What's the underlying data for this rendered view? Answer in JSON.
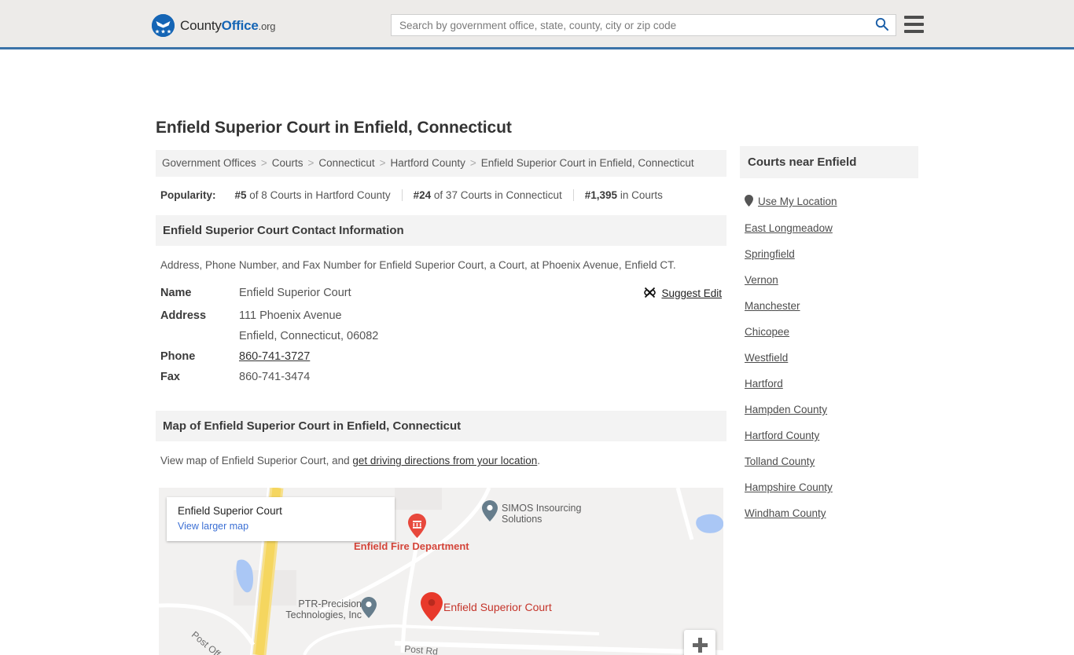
{
  "header": {
    "logo": {
      "part1": "County",
      "part2": "Office",
      "part3": ".org",
      "icon": "eagle-shield-logo"
    },
    "search": {
      "placeholder": "Search by government office, state, county, city or zip code",
      "value": "",
      "icon": "search-icon"
    },
    "menu_icon": "hamburger-menu-icon"
  },
  "page": {
    "title": "Enfield Superior Court in Enfield, Connecticut"
  },
  "breadcrumb": {
    "items": [
      "Government Offices",
      "Courts",
      "Connecticut",
      "Hartford County",
      "Enfield Superior Court in Enfield, Connecticut"
    ],
    "separator": ">"
  },
  "popularity": {
    "label": "Popularity:",
    "items": [
      {
        "rank": "#5",
        "rest": " of 8 Courts in Hartford County"
      },
      {
        "rank": "#24",
        "rest": " of 37 Courts in Connecticut"
      },
      {
        "rank": "#1,395",
        "rest": " in Courts"
      }
    ]
  },
  "contact": {
    "heading": "Enfield Superior Court Contact Information",
    "description": "Address, Phone Number, and Fax Number for Enfield Superior Court, a Court, at Phoenix Avenue, Enfield CT.",
    "rows": [
      {
        "key": "Name",
        "value": "Enfield Superior Court",
        "link": false
      },
      {
        "key": "Address",
        "value": "111 Phoenix Avenue",
        "link": false
      },
      {
        "key": "",
        "value": "Enfield, Connecticut, 06082",
        "link": false
      },
      {
        "key": "Phone",
        "value": "860-741-3727",
        "link": true
      },
      {
        "key": "Fax",
        "value": "860-741-3474",
        "link": false
      }
    ],
    "suggest_edit": {
      "label": "Suggest Edit",
      "icon": "edit-pencil-icon"
    }
  },
  "map_section": {
    "heading": "Map of Enfield Superior Court in Enfield, Connecticut",
    "desc_prefix": "View map of Enfield Superior Court, and ",
    "desc_link": "get driving directions from your location",
    "desc_suffix": ".",
    "card": {
      "title": "Enfield Superior Court",
      "link": "View larger map"
    },
    "pois": [
      {
        "name": "Enfield Fire Department",
        "type": "red-pin"
      },
      {
        "name": "SIMOS Insourcing Solutions",
        "type": "gray-pin"
      },
      {
        "name": "PTR-Precision Technologies, Inc",
        "type": "gray-pin"
      },
      {
        "name": "Enfield Superior Court",
        "type": "main-red-pin"
      }
    ],
    "roads": [
      "Post Off",
      "Post Rd"
    ],
    "zoom_in_label": "+"
  },
  "sidebar": {
    "heading": "Courts near Enfield",
    "use_my_location": {
      "label": "Use My Location",
      "icon": "location-pin-icon"
    },
    "items": [
      "East Longmeadow",
      "Springfield",
      "Vernon",
      "Manchester",
      "Chicopee",
      "Westfield",
      "Hartford",
      "Hampden County",
      "Hartford County",
      "Tolland County",
      "Hampshire County",
      "Windham County"
    ]
  },
  "colors": {
    "brand_blue": "#1565b5",
    "header_bg": "#edebe9",
    "header_border": "#3b73a8",
    "section_bg": "#f3f3f3",
    "marker_red": "#ea4335",
    "marker_gray": "#667d8c",
    "map_link_blue": "#3b6fd4"
  }
}
